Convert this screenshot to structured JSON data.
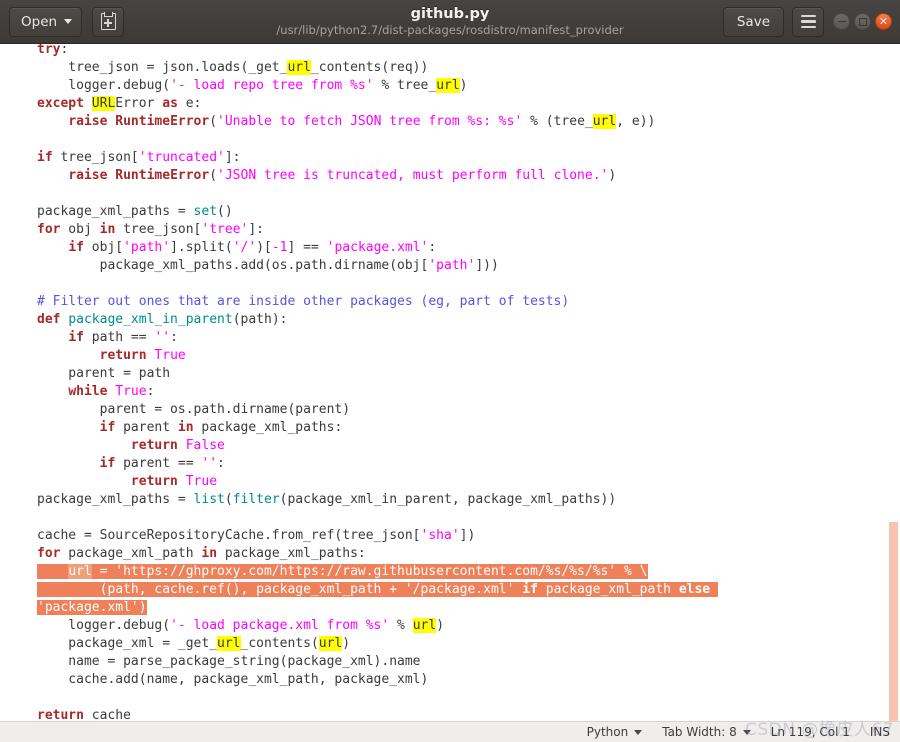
{
  "window": {
    "title": "github.py",
    "subtitle": "/usr/lib/python2.7/dist-packages/rosdistro/manifest_provider",
    "open_label": "Open",
    "save_label": "Save",
    "icons": {
      "open_caret": "chevron-down-icon",
      "new_document": "save-as-icon",
      "menu": "hamburger-menu-icon",
      "minimize": "minimize-icon",
      "maximize": "maximize-icon",
      "close": "close-icon"
    }
  },
  "statusbar": {
    "language": "Python",
    "tab_width": "Tab Width: 8",
    "cursor": "Ln 119, Col 1",
    "insert_mode": "INS",
    "watermark": "CSDN @橡皮人67"
  },
  "editor": {
    "selection_color": "#ee8159",
    "search_highlight_color": "#ffff00",
    "search_term": "url",
    "scrollbar_color": "#fac3b0",
    "code_lines": [
      "    try:",
      "        tree_json = json.loads(_get_url_contents(req))",
      "        logger.debug('- load repo tree from %s' % tree_url)",
      "    except URLError as e:",
      "        raise RuntimeError('Unable to fetch JSON tree from %s: %s' % (tree_url, e))",
      "",
      "    if tree_json['truncated']:",
      "        raise RuntimeError('JSON tree is truncated, must perform full clone.')",
      "",
      "    package_xml_paths = set()",
      "    for obj in tree_json['tree']:",
      "        if obj['path'].split('/')[-1] == 'package.xml':",
      "            package_xml_paths.add(os.path.dirname(obj['path']))",
      "",
      "    # Filter out ones that are inside other packages (eg, part of tests)",
      "    def package_xml_in_parent(path):",
      "        if path == '':",
      "            return True",
      "        parent = path",
      "        while True:",
      "            parent = os.path.dirname(parent)",
      "            if parent in package_xml_paths:",
      "                return False",
      "            if parent == '':",
      "                return True",
      "    package_xml_paths = list(filter(package_xml_in_parent, package_xml_paths))",
      "",
      "    cache = SourceRepositoryCache.from_ref(tree_json['sha'])",
      "    for package_xml_path in package_xml_paths:",
      "        url = 'https://ghproxy.com/https://raw.githubusercontent.com/%s/%s/%s' % \\",
      "            (path, cache.ref(), package_xml_path + '/package.xml' if package_xml_path else 'package.xml')",
      "        logger.debug('- load package.xml from %s' % url)",
      "        package_xml = _get_url_contents(url)",
      "        name = parse_package_string(package_xml).name",
      "        cache.add(name, package_xml_path, package_xml)",
      "",
      "    return cache"
    ]
  }
}
